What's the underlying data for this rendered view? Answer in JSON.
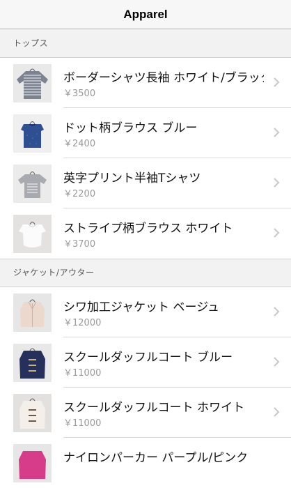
{
  "navbar": {
    "title": "Apparel"
  },
  "sections": [
    {
      "label": "トップス"
    },
    {
      "label": "ジャケット/アウター"
    }
  ],
  "items": [
    {
      "name": "ボーダーシャツ長袖 ホワイト/ブラック",
      "price": "￥3500",
      "icon": "striped-shirt-thumbnail"
    },
    {
      "name": "ドット柄ブラウス ブルー",
      "price": "￥2400",
      "icon": "blue-blouse-thumbnail"
    },
    {
      "name": "英字プリント半袖Tシャツ",
      "price": "￥2200",
      "icon": "print-tshirt-thumbnail"
    },
    {
      "name": "ストライプ柄ブラウス ホワイト",
      "price": "￥3700",
      "icon": "white-blouse-thumbnail"
    },
    {
      "name": "シワ加工ジャケット ベージュ",
      "price": "￥12000",
      "icon": "beige-jacket-thumbnail"
    },
    {
      "name": "スクールダッフルコート ブルー",
      "price": "￥11000",
      "icon": "blue-duffle-coat-thumbnail"
    },
    {
      "name": "スクールダッフルコート ホワイト",
      "price": "￥11000",
      "icon": "white-duffle-coat-thumbnail"
    },
    {
      "name": "ナイロンパーカー パープル/ピンク",
      "price": "",
      "icon": "purple-parka-thumbnail"
    }
  ]
}
